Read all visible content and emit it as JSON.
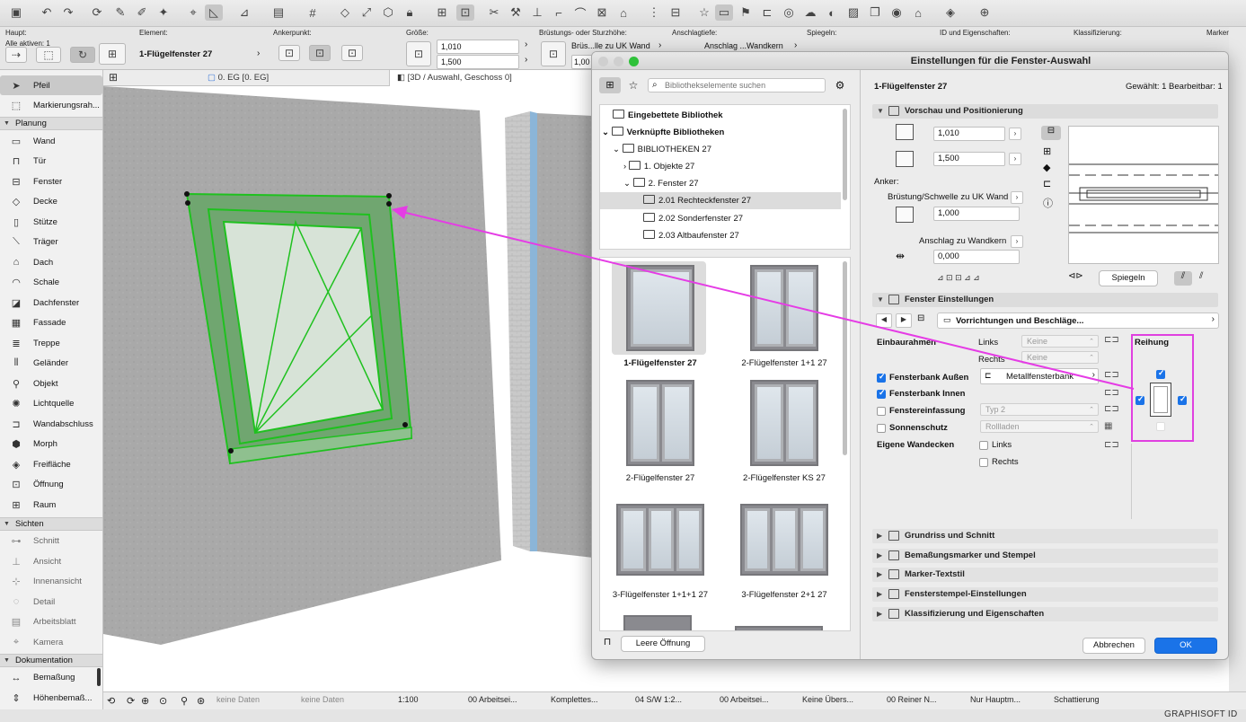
{
  "infobox": {
    "labels": {
      "haupt": "Haupt:",
      "alle_aktiven": "Alle aktiven: 1",
      "element": "Element:",
      "ankerpunkt": "Ankerpunkt:",
      "groesse": "Größe:",
      "bruestung": "Brüstungs- oder Sturzhöhe:",
      "anschlagtiefe": "Anschlagtiefe:",
      "spiegeln": "Spiegeln:",
      "id_eigenschaften": "ID und Eigenschaften:",
      "klassifizierung": "Klassifizierung:",
      "markertyp": "Markertyp:"
    },
    "element_value": "1-Flügelfenster 27",
    "width": "1,010",
    "height": "1,500",
    "bruestung_value": "Brüs...lle zu UK Wand",
    "bruestung_num": "1,00",
    "anschlag_value": "Anschlag ...Wandkern"
  },
  "tabs": {
    "floorplan": "0. EG [0. EG]",
    "view3d": "[3D / Auswahl, Geschoss 0]"
  },
  "toolbox": {
    "pfeil": "Pfeil",
    "markierungsrahmen": "Markierungsrah...",
    "group_planung": "Planung",
    "planung": [
      "Wand",
      "Tür",
      "Fenster",
      "Decke",
      "Stütze",
      "Träger",
      "Dach",
      "Schale",
      "Dachfenster",
      "Fassade",
      "Treppe",
      "Geländer",
      "Objekt",
      "Lichtquelle",
      "Wandabschluss",
      "Morph",
      "Freifläche",
      "Öffnung",
      "Raum"
    ],
    "group_sichten": "Sichten",
    "sichten": [
      "Schnitt",
      "Ansicht",
      "Innenansicht",
      "Detail",
      "Arbeitsblatt",
      "Kamera"
    ],
    "group_dokumentation": "Dokumentation",
    "dokumentation": [
      "Bemaßung",
      "Höhenbemaß..."
    ]
  },
  "status": {
    "keine1": "keine Daten",
    "keine2": "keine Daten",
    "scale": "1:100",
    "layer": "00 Arbeitsei...",
    "model": "Komplettes...",
    "pen": "04 S/W 1:2...",
    "layer2": "00 Arbeitsei...",
    "override": "Keine Übers...",
    "renovation": "00 Reiner N...",
    "structure": "Nur Hauptm...",
    "shading": "Schattierung",
    "brand": "GRAPHISOFT ID"
  },
  "dialog": {
    "title": "Einstellungen für die Fenster-Auswahl",
    "search_placeholder": "Bibliothekselemente suchen",
    "tree": {
      "embedded": "Eingebettete Bibliothek",
      "linked": "Verknüpfte Bibliotheken",
      "bib27": "BIBLIOTHEKEN 27",
      "objekte": "1. Objekte 27",
      "fenster": "2. Fenster 27",
      "rechteck": "2.01 Rechteckfenster 27",
      "sonder": "2.02 Sonderfenster 27",
      "altbau": "2.03 Altbaufenster 27"
    },
    "thumbs": [
      "1-Flügelfenster 27",
      "2-Flügelfenster 1+1 27",
      "2-Flügelfenster 27",
      "2-Flügelfenster KS 27",
      "3-Flügelfenster 1+1+1 27",
      "3-Flügelfenster 2+1 27"
    ],
    "leere_oeffnung": "Leere Öffnung",
    "element_name": "1-Flügelfenster 27",
    "selection_info": "Gewählt: 1 Bearbeitbar: 1",
    "sections": {
      "vorschau": "Vorschau und Positionierung",
      "fenster_einst": "Fenster Einstellungen",
      "grundriss": "Grundriss und Schnitt",
      "bemassung": "Bemaßungsmarker und Stempel",
      "marker": "Marker-Textstil",
      "stempel": "Fensterstempel-Einstellungen",
      "klassifizierung": "Klassifizierung und Eigenschaften"
    },
    "preview": {
      "width": "1,010",
      "height": "1,500",
      "anker": "Anker:",
      "bruestung_label": "Brüstung/Schwelle zu UK Wand",
      "bruestung_value": "1,000",
      "anschlag_label": "Anschlag zu Wandkern",
      "anschlag_value": "0,000",
      "spiegeln": "Spiegeln"
    },
    "settings": {
      "page_title": "Vorrichtungen und Beschläge...",
      "einbaurahmen": "Einbaurahmen",
      "links": "Links",
      "rechts": "Rechts",
      "keine1": "Keine",
      "keine2": "Keine",
      "fb_aussen": "Fensterbank Außen",
      "fb_aussen_value": "Metallfensterbank",
      "fb_innen": "Fensterbank Innen",
      "einfassung": "Fenstereinfassung",
      "einfassung_value": "Typ 2",
      "sonnenschutz": "Sonnenschutz",
      "sonnenschutz_value": "Rollladen",
      "wandecken": "Eigene Wandecken",
      "wandecken_links": "Links",
      "wandecken_rechts": "Rechts",
      "reihung": "Reihung"
    },
    "buttons": {
      "abbrechen": "Abbrechen",
      "ok": "OK"
    }
  }
}
